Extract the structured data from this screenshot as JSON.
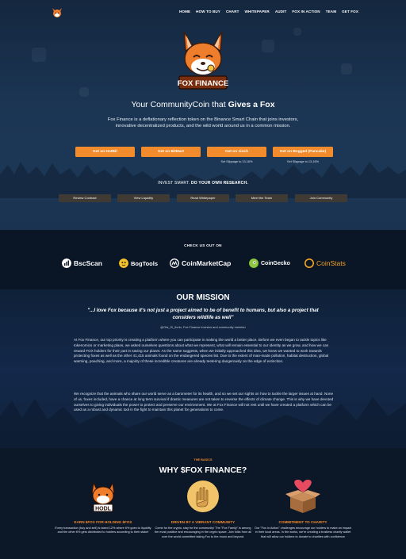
{
  "nav": {
    "items": [
      "HOME",
      "HOW TO BUY",
      "CHART",
      "WHITEPAPER",
      "AUDIT",
      "FOX IN ACTION",
      "TEAM",
      "GET FOX"
    ]
  },
  "hero": {
    "logo_text": "FOX FINANCE",
    "tagline_plain": "Your CommunityCoin that ",
    "tagline_bold": "Gives a Fox",
    "description": "Fox Finance is a deflationary reflection token on the Binance Smart Chain that joins investors, innovative decentralized products, and the wild world around us in a common mission.",
    "buy_buttons": [
      "Get on HotBit",
      "Get on BitMart",
      "Get on 1inch",
      "Get on Bogged (Pancake)"
    ],
    "slippage_note": "Set Slippage to 13-16%",
    "invest_plain": "INVEST SMART. ",
    "invest_bold": "DO YOUR OWN RESEARCH.",
    "secondary_buttons": [
      "Review Contract",
      "View Liquidity",
      "Read Whitepaper",
      "Meet the Team",
      "Join Community"
    ]
  },
  "partners": {
    "title": "CHECK US OUT ON",
    "items": [
      {
        "name": "BscScan",
        "icon": "bscscan-icon",
        "color": "#ffffff"
      },
      {
        "name": "BogTools",
        "icon": "bogtools-icon",
        "color": "#f2c12e"
      },
      {
        "name": "CoinMarketCap",
        "icon": "coinmarketcap-icon",
        "color": "#ffffff"
      },
      {
        "name": "CoinGecko",
        "icon": "coingecko-icon",
        "color": "#8dc63f"
      },
      {
        "name": "CoinStats",
        "icon": "coinstats-icon",
        "color": "#f5a623"
      }
    ]
  },
  "mission": {
    "title": "OUR MISSION",
    "quote": "\"...I love Fox because it's not just a project aimed to be of benefit to humans, but also a project that considers wildlife as well\"",
    "attribution": "@Ola_Ol_Ilorin, Fox Finance investor and community member",
    "paragraph1": "At Fox Finance, our top priority is creating a platform where you can participate in making the world a better place. Before we even began to tackle topics like tokenomics or marketing plans, we asked ourselves questions about what we represent, what will remain essential to our identity as we grow, and how we can reward FOX holders for their part in saving our planet. As the name suggests, when we initially approached this idea, we knew we wanted to work towards protecting foxes as well as the other 41,415 animals found on the endangered species list. Due to the extent of man-made pollution, habitat destruction, global warming, poaching, and more, a majority of these incredible creatures are already teetering dangerously on the edge of extinction.",
    "paragraph2": "We recognize that the animals who share our world serve as a barometer for its health, and so we set our sights on how to tackle the larger issues at hand. None of us, foxes included, have a chance at long term survival if drastic measures are not taken to reverse the effects of climate change. This is why we have devoted ourselves to giving individuals the power to protect and preserve our environment. We at Fox Finance will not rest until we have created a platform which can be used as a robust and dynamic tool in the fight to maintain this planet for generations to come."
  },
  "why": {
    "eyebrow": "THE BASICS",
    "title": "WHY $FOX FINANCE?",
    "columns": [
      {
        "heading": "EARN $FOX FOR HOLDING $FOX",
        "icon": "hodl-fox-icon",
        "text": "Every transaction (buy and sell) is taxed 12% where 6% goes to liquidity and the other 6% gets distributed to holders according to their stake!"
      },
      {
        "heading": "DRIVEN BY A VIBRANT COMMUNITY",
        "icon": "community-hands-icon",
        "text": "Come for the crypto, stay for the community! The \"Fox Family\" is among the most positive and encouraging in the crypto space. Join folks from all over the world committed taking Fox to the moon and beyond."
      },
      {
        "heading": "COMMITMENT TO CHARITY",
        "icon": "charity-box-icon",
        "text": "Our \"Fox in Action\" challenges encourage our holders to make an impact in their local areas. In the works, we're creating a trustless charity wallet that will allow our holders to donate to charities with confidence"
      }
    ]
  },
  "colors": {
    "accent": "#f28b2b",
    "secondary_button": "#3f3a34",
    "hero_bg": "#1b3553",
    "dark_bg": "#0a1526"
  }
}
